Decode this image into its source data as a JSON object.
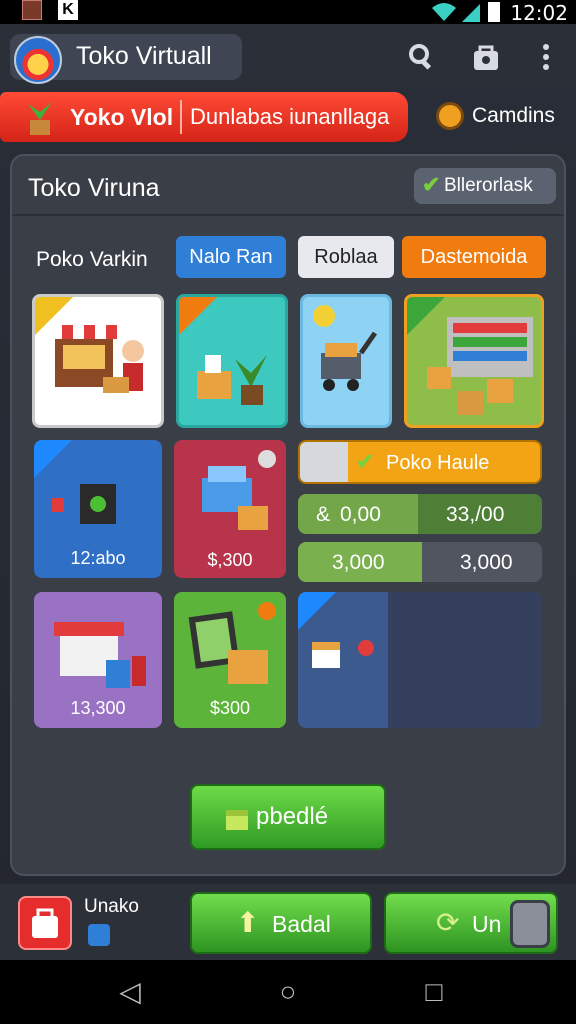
{
  "status_bar": {
    "time": "12:02"
  },
  "header": {
    "title": "Toko Virtuall"
  },
  "tabs": {
    "active_left": "Yoko Vlol",
    "active_right": "Dunlabas iunanllaga",
    "coins": "Camdins"
  },
  "panel": {
    "title": "Toko Viruna",
    "badge_label": "Bllerorlask",
    "filter_label": "Poko Varkin",
    "filters": [
      "Nalo Ran",
      "Roblaa",
      "Dastemoida"
    ],
    "cards": [
      {
        "price": ""
      },
      {
        "price": ""
      },
      {
        "price": ""
      },
      {
        "price": ""
      },
      {
        "price": "12:abo"
      },
      {
        "price": "$,300"
      },
      {
        "price": "13,300"
      },
      {
        "price": "$300"
      }
    ],
    "promo_label": "Poko Haule",
    "stats": [
      {
        "left": "0,00",
        "right": "33,/00"
      },
      {
        "left": "3,000",
        "right": "3,000"
      }
    ],
    "upgrade_label": "pbedlé"
  },
  "bottom": {
    "bag_label": "Unako",
    "btn_center": "Badal",
    "btn_right": "Un"
  },
  "colors": {
    "red": "#e0281c",
    "green": "#4cbf34",
    "blue": "#2f7fd6",
    "orange": "#f07c10"
  }
}
